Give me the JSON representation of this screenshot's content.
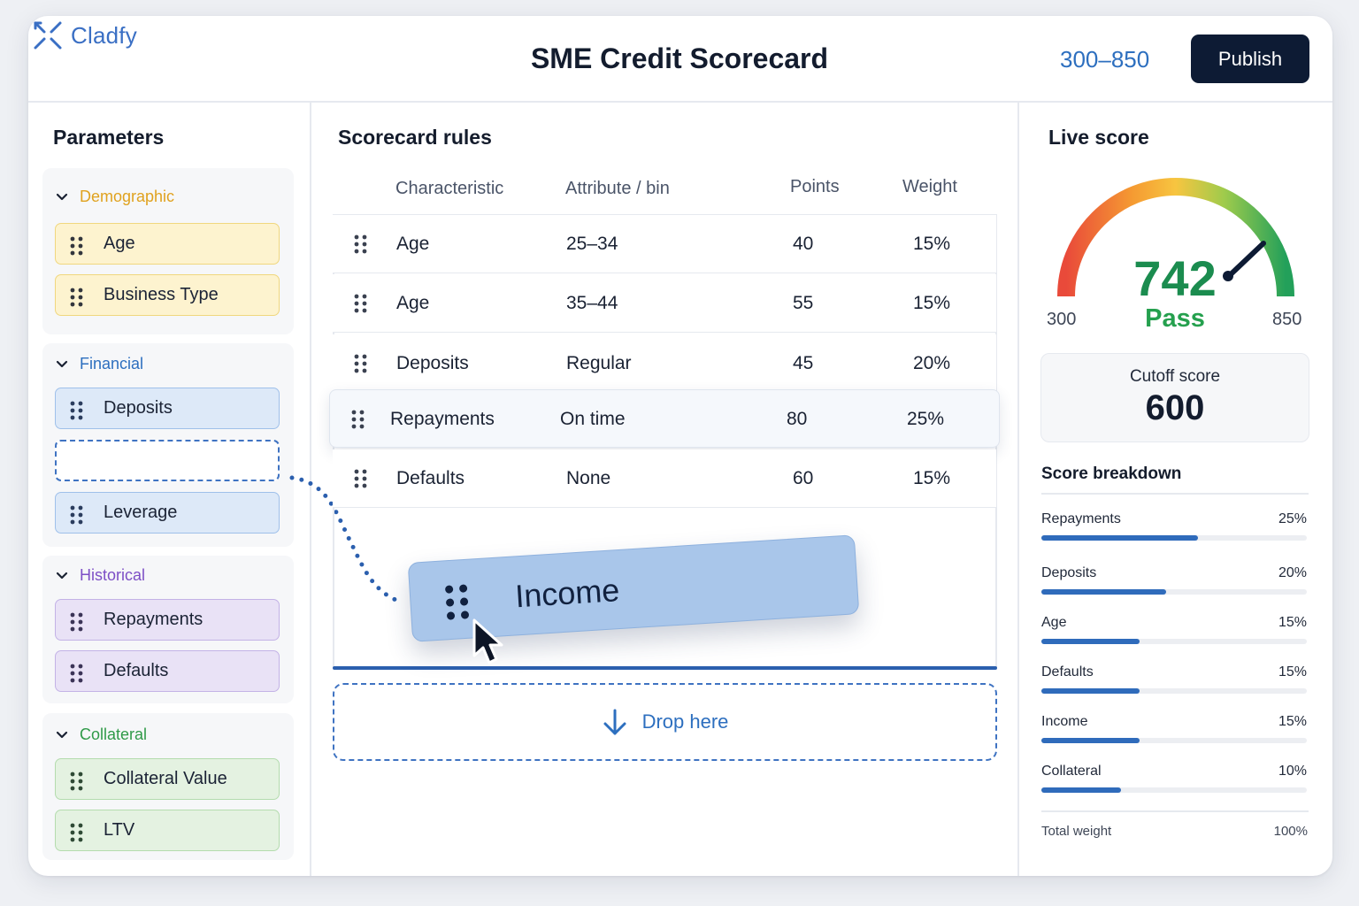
{
  "app": {
    "logo_text": "Cladfy",
    "title": "SME Credit Scorecard",
    "score_range": "300–850",
    "publish_label": "Publish"
  },
  "parameters": {
    "title": "Parameters",
    "groups": [
      {
        "name": "Demographic",
        "color": "#e0a21f",
        "items": [
          "Age",
          "Business Type"
        ]
      },
      {
        "name": "Financial",
        "color": "#2d6fbf",
        "items": [
          "Deposits",
          "Leverage"
        ]
      },
      {
        "name": "Historical",
        "color": "#7d4fc6",
        "items": [
          "Repayments",
          "Defaults"
        ]
      },
      {
        "name": "Collateral",
        "color": "#2f9a48",
        "items": [
          "Collateral Value",
          "LTV"
        ]
      }
    ]
  },
  "rules": {
    "title": "Scorecard rules",
    "columns": [
      "Characteristic",
      "Attribute / bin",
      "Points",
      "Weight"
    ],
    "rows": [
      {
        "characteristic": "Age",
        "attribute": "25–34",
        "points": "40",
        "weight": "15%"
      },
      {
        "characteristic": "Age",
        "attribute": "35–44",
        "points": "55",
        "weight": "15%"
      },
      {
        "characteristic": "Deposits",
        "attribute": "Regular",
        "points": "45",
        "weight": "20%"
      },
      {
        "characteristic": "Repayments",
        "attribute": "On time",
        "points": "80",
        "weight": "25%"
      },
      {
        "characteristic": "Defaults",
        "attribute": "None",
        "points": "60",
        "weight": "15%"
      }
    ],
    "dragging_item": "Income",
    "drop_label": "Drop here"
  },
  "live_score": {
    "title": "Live score",
    "score": "742",
    "status": "Pass",
    "min": "300",
    "max": "850",
    "cutoff_label": "Cutoff score",
    "cutoff_value": "600",
    "breakdown_title": "Score breakdown",
    "breakdown": [
      {
        "label": "Repayments",
        "pct": "25%",
        "fill": 0.59
      },
      {
        "label": "Deposits",
        "pct": "20%",
        "fill": 0.47
      },
      {
        "label": "Age",
        "pct": "15%",
        "fill": 0.37
      },
      {
        "label": "Defaults",
        "pct": "15%",
        "fill": 0.37
      },
      {
        "label": "Income",
        "pct": "15%",
        "fill": 0.37
      },
      {
        "label": "Collateral",
        "pct": "10%",
        "fill": 0.3
      }
    ],
    "total_label": "Total weight",
    "total_value": "100%"
  },
  "colors": {
    "accent": "#2d6fbf",
    "publish_bg": "#0d1b34",
    "pass": "#25a04e"
  }
}
